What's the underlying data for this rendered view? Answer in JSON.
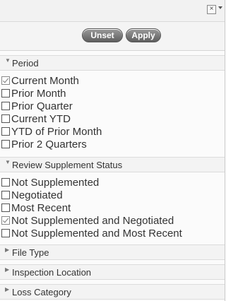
{
  "toolbar": {
    "unset_label": "Unset",
    "apply_label": "Apply",
    "close_glyph": "×"
  },
  "sections": {
    "period": {
      "title": "Period",
      "expanded": true,
      "options": [
        {
          "label": "Current Month",
          "checked": true
        },
        {
          "label": "Prior Month",
          "checked": false
        },
        {
          "label": "Prior Quarter",
          "checked": false
        },
        {
          "label": "Current YTD",
          "checked": false
        },
        {
          "label": "YTD of Prior Month",
          "checked": false
        },
        {
          "label": "Prior 2 Quarters",
          "checked": false
        }
      ]
    },
    "review": {
      "title": "Review Supplement Status",
      "expanded": true,
      "options": [
        {
          "label": "Not Supplemented",
          "checked": false
        },
        {
          "label": "Negotiated",
          "checked": false
        },
        {
          "label": "Most Recent",
          "checked": false
        },
        {
          "label": "Not Supplemented and Negotiated",
          "checked": true
        },
        {
          "label": "Not Supplemented and Most Recent",
          "checked": false
        }
      ]
    },
    "file_type": {
      "title": "File Type",
      "expanded": false
    },
    "inspection_location": {
      "title": "Inspection Location",
      "expanded": false
    },
    "loss_category": {
      "title": "Loss Category",
      "expanded": false
    }
  },
  "icons": {
    "expanded": "▼",
    "collapsed": "▶"
  }
}
